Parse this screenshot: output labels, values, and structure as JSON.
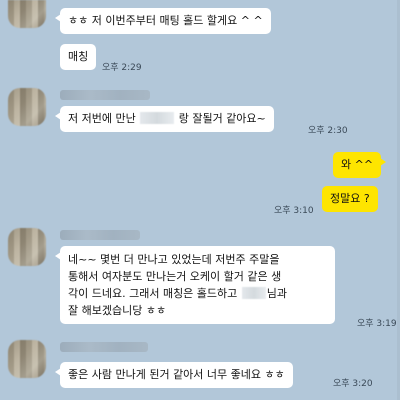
{
  "messages": [
    {
      "id": "m1",
      "side": "left",
      "text": "ㅎㅎ 저 이번주부터 매팅 홀드 할게요 ^ ^",
      "time": ""
    },
    {
      "id": "m2",
      "side": "left",
      "text": "매칭",
      "time": "오후 2:29"
    },
    {
      "id": "m3",
      "side": "left",
      "text_before": "저 저번에 만난",
      "text_after": "랑 잘될거 같아요~",
      "time": "오후 2:30"
    },
    {
      "id": "m4",
      "side": "right",
      "text": "와 ^^",
      "time": ""
    },
    {
      "id": "m5",
      "side": "right",
      "text": "정말요 ?",
      "time": "오후 3:10"
    },
    {
      "id": "m6",
      "side": "left",
      "line1": "네~~ 몇번 더 만나고 있었는데 저번주 주말을",
      "line2": "통해서 여자분도 만나는거 오케이 할거 같은 생",
      "line3_before": "각이 드네요. 그래서 매칭은 홀드하고",
      "line3_after": "님과",
      "line4": "잘 해보겠습니당 ㅎㅎ",
      "time": "오후 3:19"
    },
    {
      "id": "m7",
      "side": "left",
      "text": "좋은 사람 만나게 된거 같아서 너무 좋네요 ㅎㅎ",
      "time": "오후 3:20"
    }
  ],
  "colors": {
    "background": "#b2c7d9",
    "my_bubble": "#fee500",
    "their_bubble": "#ffffff"
  }
}
